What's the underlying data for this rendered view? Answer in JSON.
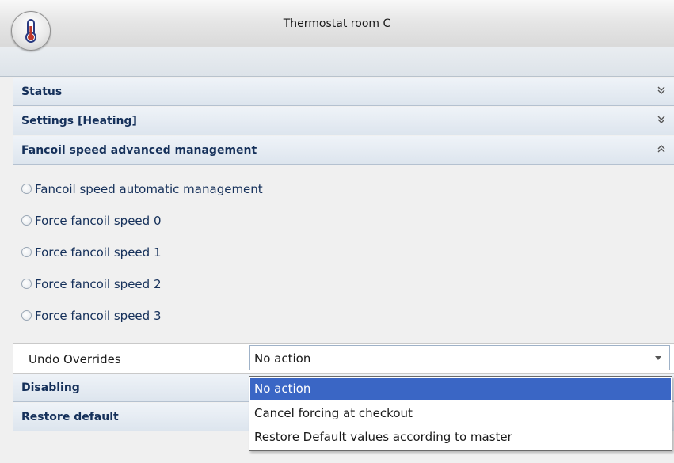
{
  "window": {
    "title": "Thermostat room C",
    "icon": "thermometer-icon"
  },
  "sections": [
    {
      "label": "Status",
      "state": "collapsed",
      "chevron": "double-chevron-down-icon"
    },
    {
      "label": "Settings [Heating]",
      "state": "collapsed",
      "chevron": "double-chevron-down-icon"
    },
    {
      "label": "Fancoil speed advanced management",
      "state": "expanded",
      "chevron": "double-chevron-up-icon"
    },
    {
      "label": "Disabling",
      "state": "collapsed"
    },
    {
      "label": "Restore default",
      "state": "collapsed"
    }
  ],
  "fancoil": {
    "options": [
      "Fancoil speed automatic management",
      "Force fancoil speed 0",
      "Force fancoil speed 1",
      "Force fancoil speed 2",
      "Force fancoil speed 3"
    ]
  },
  "undo": {
    "label": "Undo Overrides",
    "value": "No action",
    "options": [
      "No action",
      "Cancel forcing at checkout",
      "Restore Default values according to master"
    ],
    "selected_index": 0
  },
  "colors": {
    "header_text": "#15305a",
    "selection": "#3a66c5"
  }
}
